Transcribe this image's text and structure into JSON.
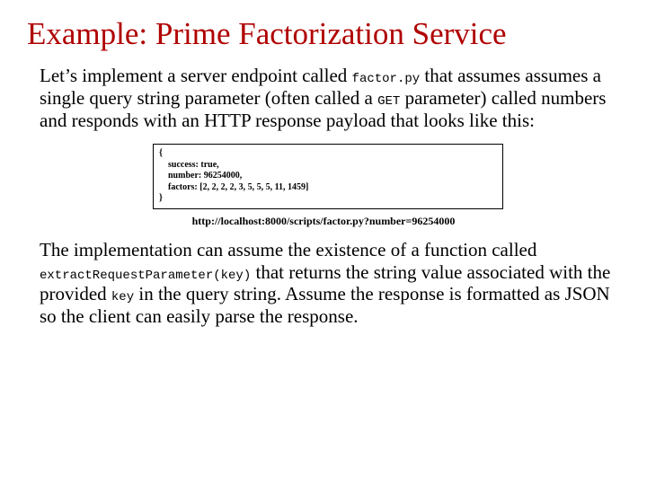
{
  "title": "Example: Prime Factorization Service",
  "para1_a": "Let’s implement a server endpoint called ",
  "para1_code_factor": "factor.py",
  "para1_b": " that assumes assumes a single query string parameter (often called a ",
  "para1_code_get": "GET",
  "para1_c": " parameter) called numbers and responds with an HTTP response payload that looks like this:",
  "code_block": "{\n    success: true,\n    number: 96254000,\n    factors: [2, 2, 2, 2, 3, 5, 5, 5, 11, 1459]\n}",
  "url": "http://localhost:8000/scripts/factor.py?number=96254000",
  "para2_a": "The implementation can assume the existence of a function called ",
  "para2_code_extract": "extractRequestParameter(key)",
  "para2_b": " that returns the string value associated with the provided ",
  "para2_code_key": "key",
  "para2_c": " in the query string.  Assume the response is formatted as JSON so the client can easily parse the response."
}
